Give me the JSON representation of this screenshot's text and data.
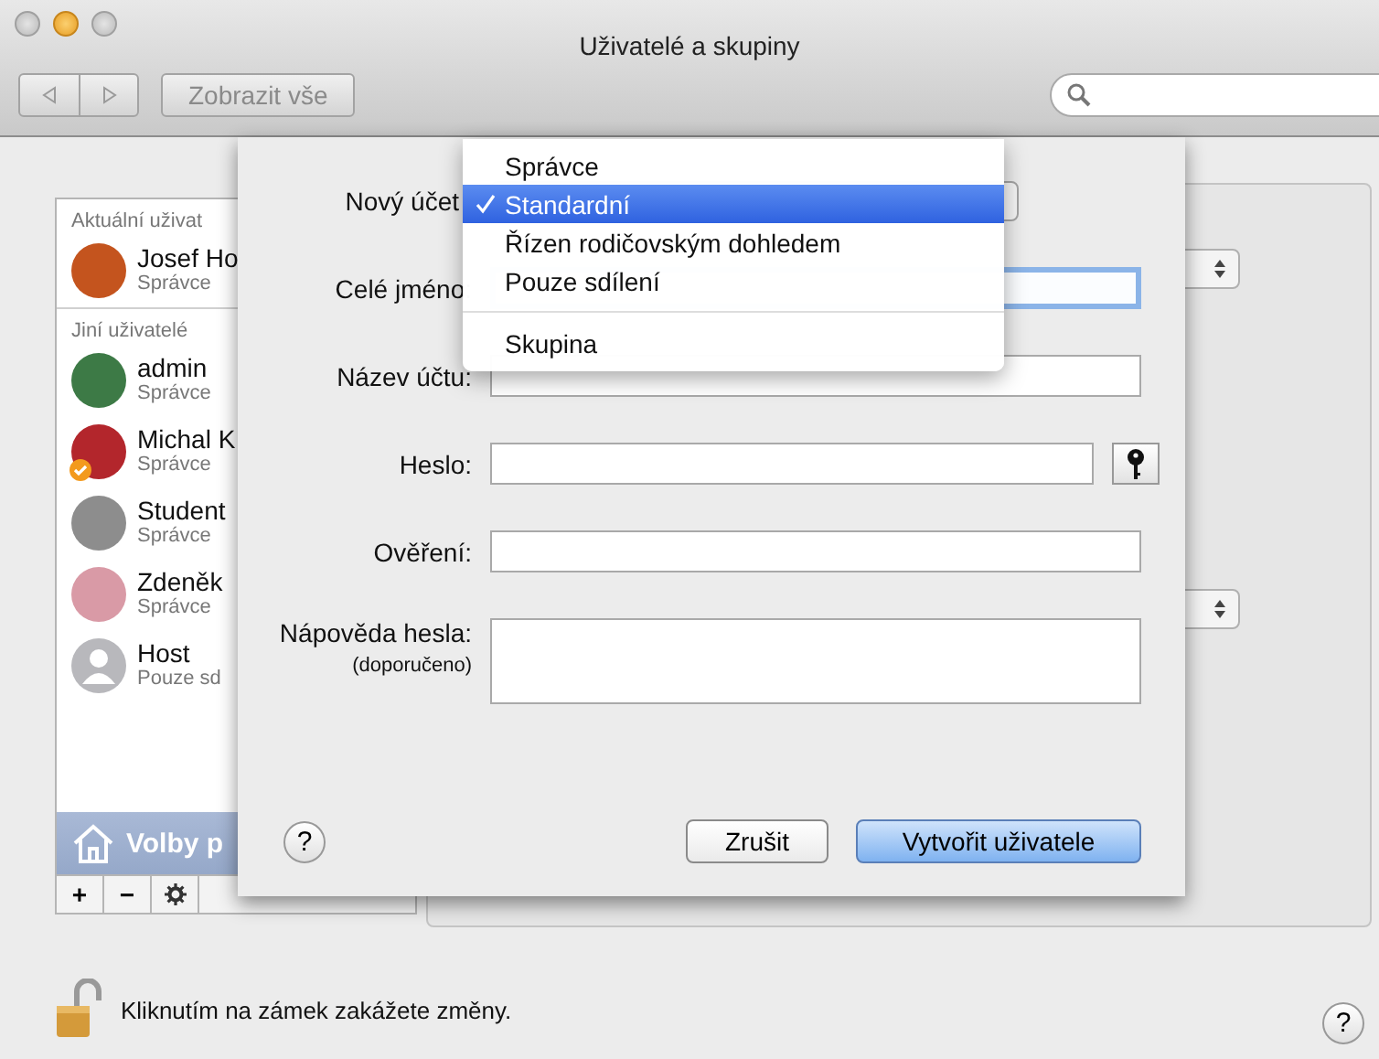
{
  "window": {
    "title": "Uživatelé a skupiny"
  },
  "toolbar": {
    "show_all": "Zobrazit vše"
  },
  "sidebar": {
    "sections": [
      {
        "heading": "Aktuální uživat",
        "users": [
          {
            "name": "Josef Ho",
            "role": "Správce",
            "kind": "photo",
            "color": "#c4541e",
            "badge": false
          }
        ]
      },
      {
        "heading": "Jiní uživatelé",
        "users": [
          {
            "name": "admin",
            "role": "Správce",
            "kind": "photo",
            "color": "#3d7a46",
            "badge": false
          },
          {
            "name": "Michal K",
            "role": "Správce",
            "kind": "photo",
            "color": "#b3262c",
            "badge": true
          },
          {
            "name": "Student",
            "role": "Správce",
            "kind": "photo",
            "color": "#8d8d8d",
            "badge": false
          },
          {
            "name": "Zdeněk",
            "role": "Správce",
            "kind": "photo",
            "color": "#d99aa6",
            "badge": false
          },
          {
            "name": "Host",
            "role": "Pouze sd",
            "kind": "guest",
            "color": "#b8b8bc",
            "badge": false
          }
        ]
      }
    ],
    "login_options": "Volby p",
    "add": "+",
    "remove": "−"
  },
  "sheet": {
    "rows": [
      {
        "label": "Nový účet",
        "kind": "popup"
      },
      {
        "label": "Celé jméno:",
        "kind": "text",
        "focused": true
      },
      {
        "label": "Název účtu:",
        "kind": "text",
        "focused": false
      },
      {
        "label": "Heslo:",
        "kind": "password",
        "focused": false
      },
      {
        "label": "Ověření:",
        "kind": "text",
        "focused": false
      },
      {
        "label": "Nápověda hesla:",
        "sublabel": "(doporučeno)",
        "kind": "textarea",
        "focused": false
      }
    ],
    "menu": [
      {
        "label": "Správce",
        "selected": false,
        "separator_before": false
      },
      {
        "label": "Standardní",
        "selected": true,
        "separator_before": false
      },
      {
        "label": "Řízen rodičovským dohledem",
        "selected": false,
        "separator_before": false
      },
      {
        "label": "Pouze sdílení",
        "selected": false,
        "separator_before": false
      },
      {
        "label": "Skupina",
        "selected": false,
        "separator_before": true
      }
    ],
    "help": "?",
    "buttons": [
      {
        "label": "Zrušit",
        "default": false
      },
      {
        "label": "Vytvořit uživatele",
        "default": true
      }
    ]
  },
  "footer": {
    "lock_text": "Kliknutím na zámek zakážete změny.",
    "help": "?"
  }
}
